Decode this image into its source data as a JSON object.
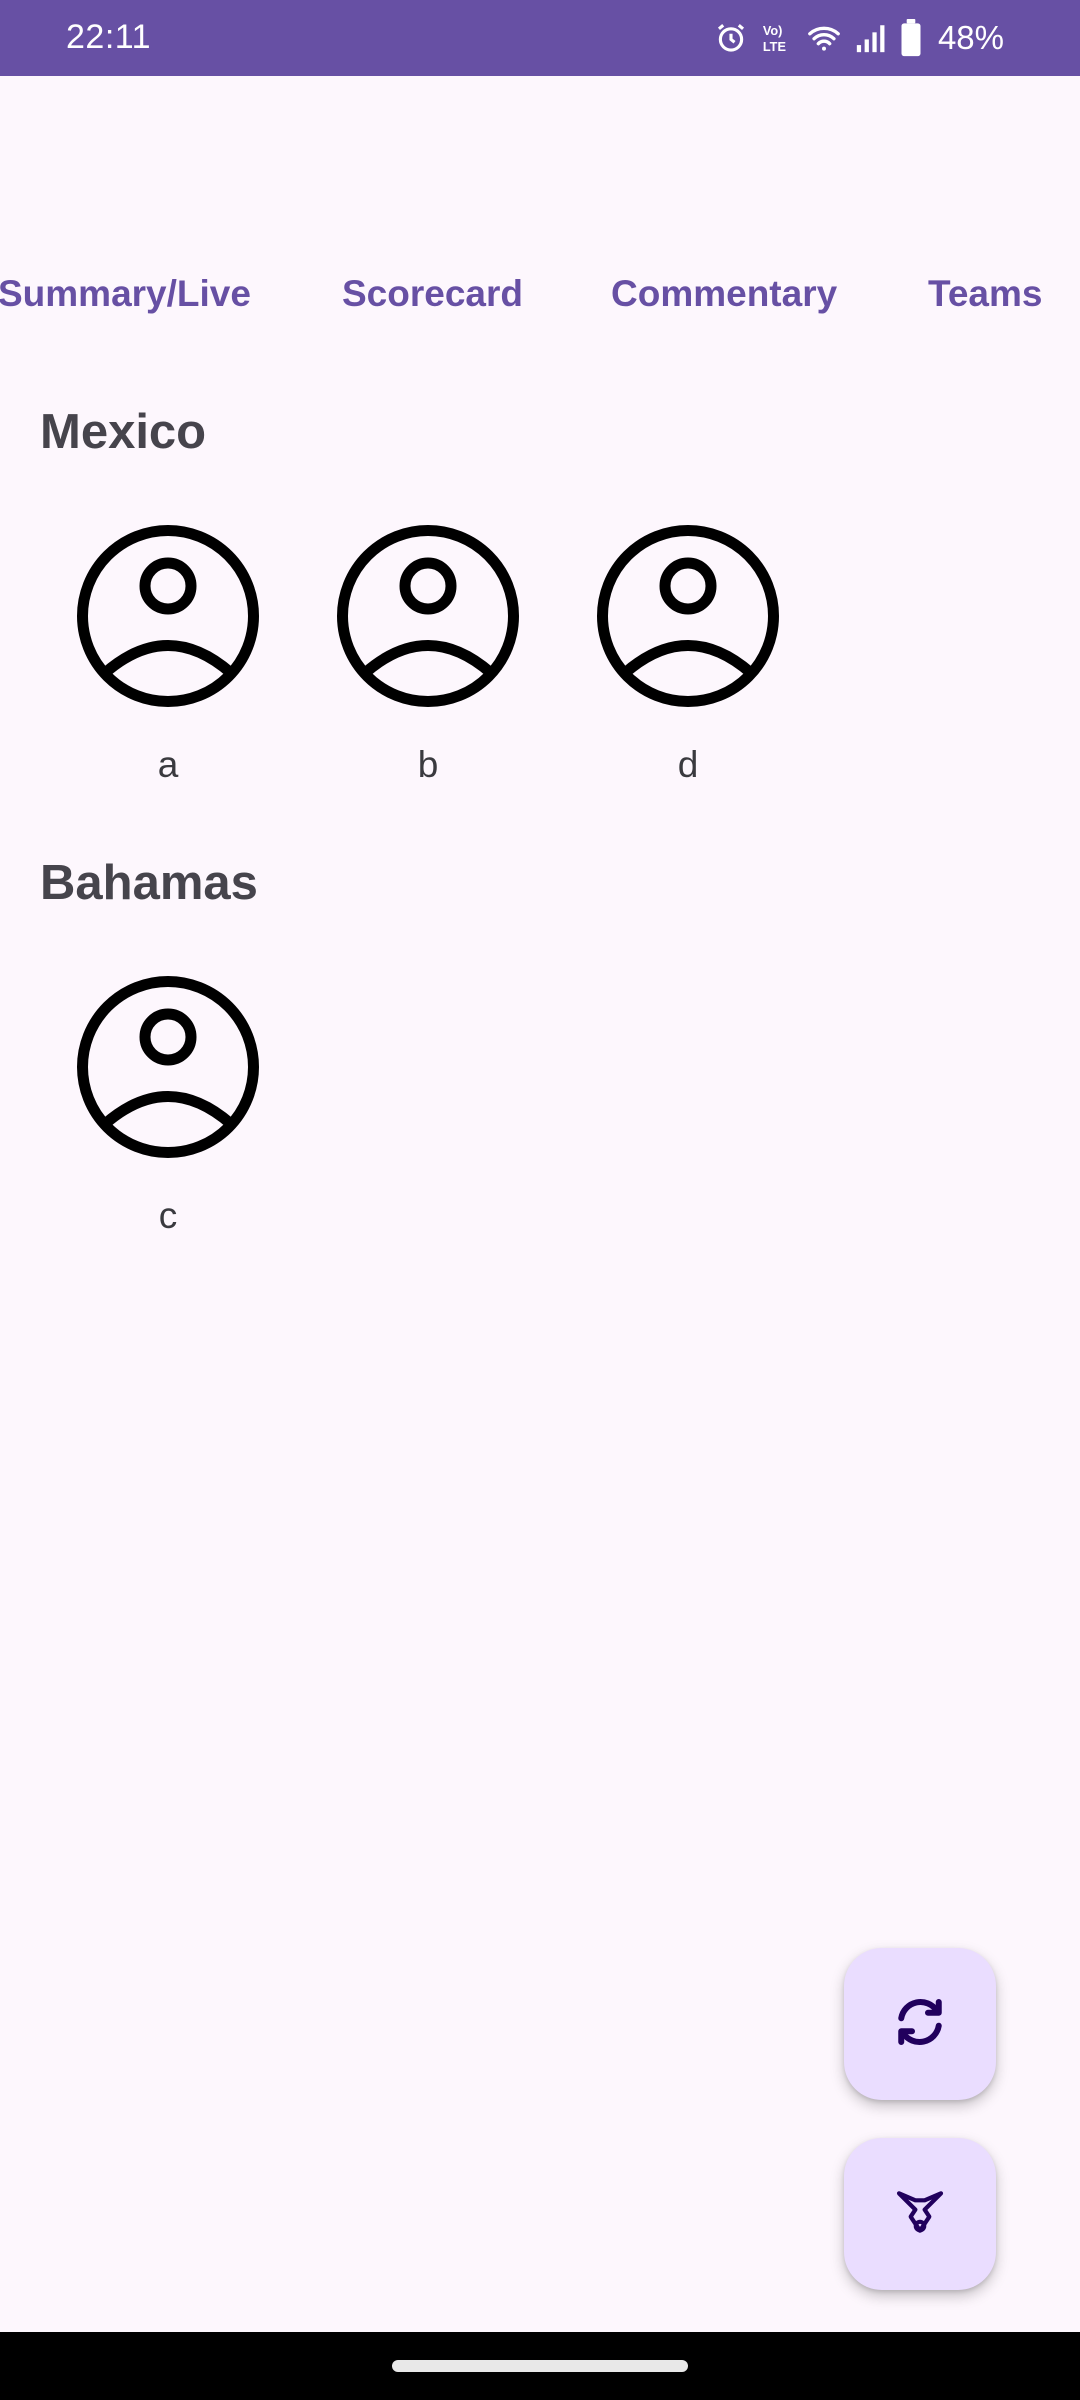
{
  "status_bar": {
    "time": "22:11",
    "battery_percent": "48%",
    "icons": [
      "alarm-icon",
      "volte-icon",
      "wifi-icon",
      "signal-icon",
      "battery-icon"
    ]
  },
  "tabs": [
    {
      "label": "Summary/Live"
    },
    {
      "label": "Scorecard"
    },
    {
      "label": "Commentary"
    },
    {
      "label": "Teams"
    }
  ],
  "teams": [
    {
      "name": "Mexico",
      "players": [
        {
          "name": "a",
          "icon": "account-circle-icon"
        },
        {
          "name": "b",
          "icon": "account-circle-icon"
        },
        {
          "name": "d",
          "icon": "account-circle-icon"
        }
      ]
    },
    {
      "name": "Bahamas",
      "players": [
        {
          "name": "c",
          "icon": "account-circle-icon"
        }
      ]
    }
  ],
  "fabs": [
    {
      "icon": "refresh-icon"
    },
    {
      "icon": "horns-icon"
    }
  ],
  "colors": {
    "primary": "#6750A4",
    "background": "#FDF7FD",
    "fab_container": "#EADDFF",
    "team_title": "#46444C"
  }
}
